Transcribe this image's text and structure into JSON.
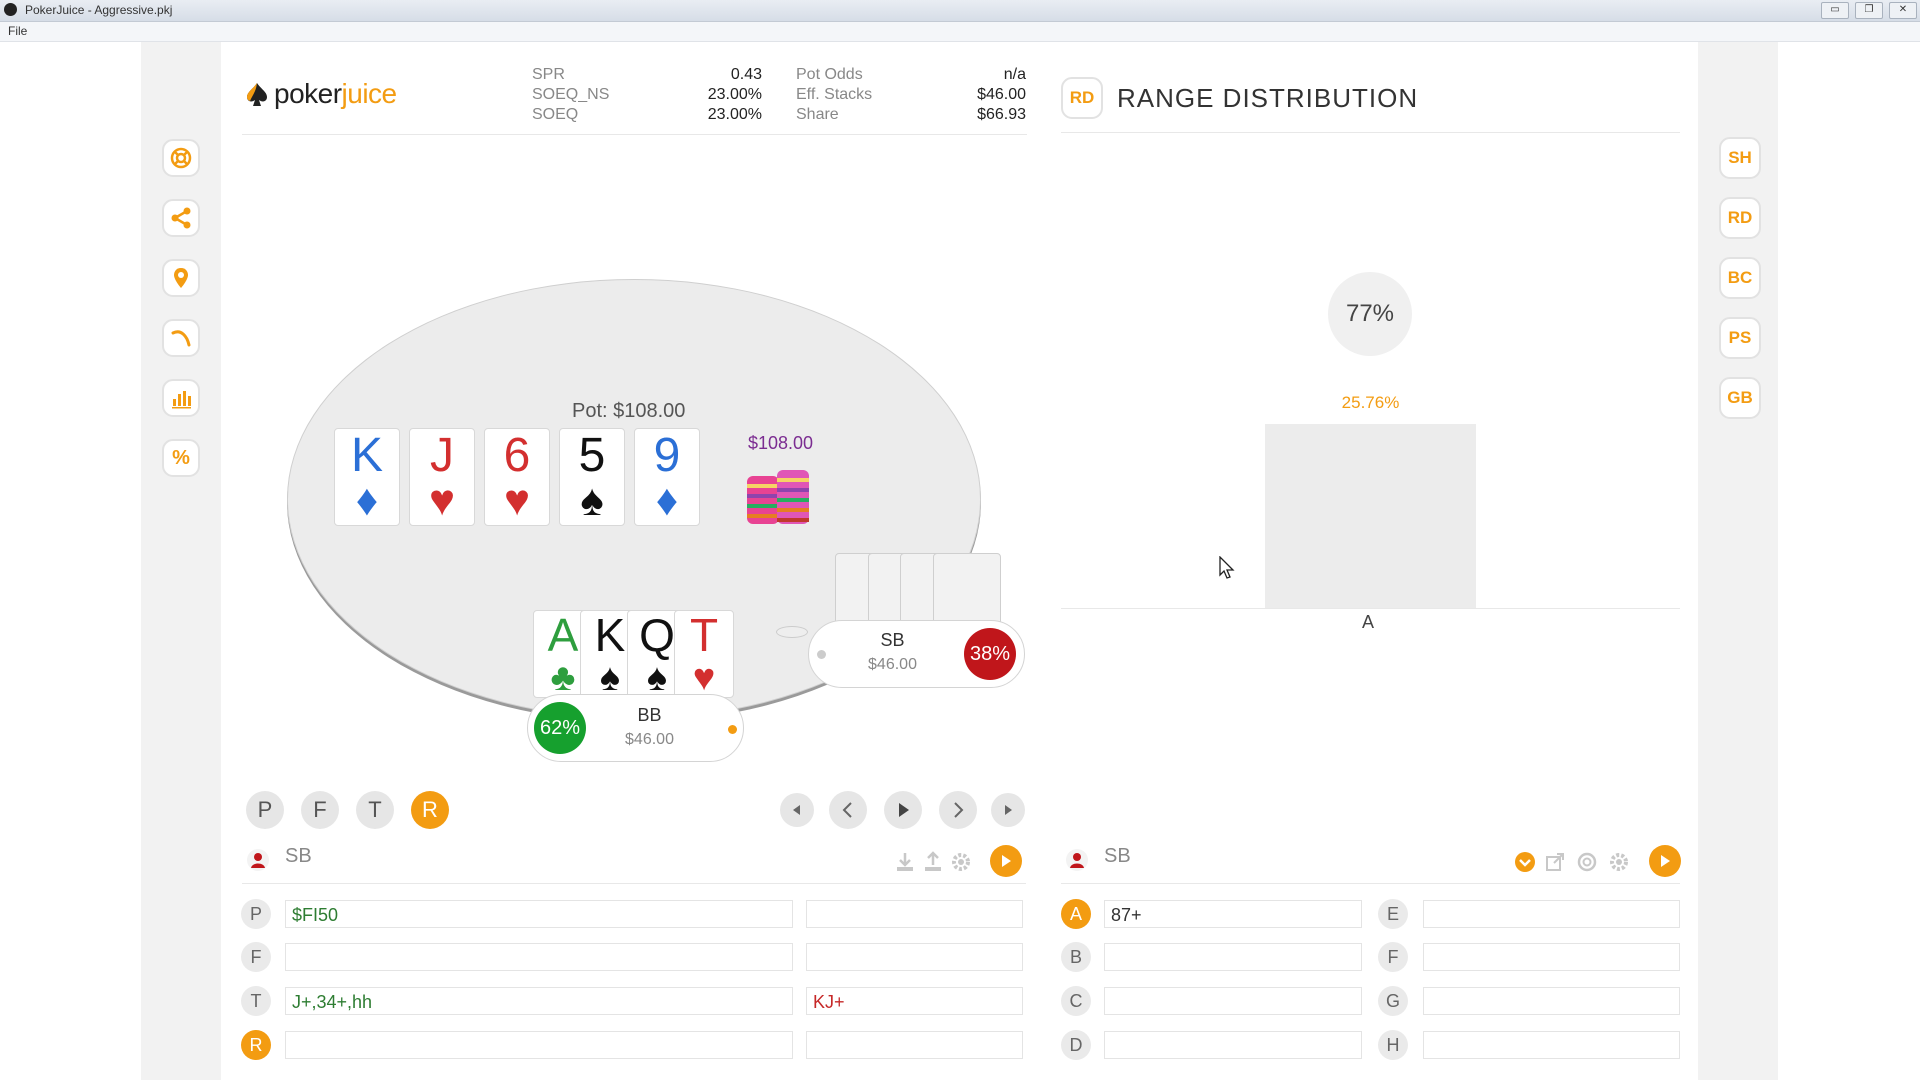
{
  "window": {
    "title": "PokerJuice - Aggressive.pkj",
    "min": "▭",
    "restore": "❐",
    "close": "✕"
  },
  "menu": {
    "file": "File"
  },
  "logo": {
    "part1": "poker",
    "part2": "juice"
  },
  "stats": {
    "col1": [
      {
        "label": "SPR",
        "value": "0.43"
      },
      {
        "label": "SOEQ_NS",
        "value": "23.00%"
      },
      {
        "label": "SOEQ",
        "value": "23.00%"
      }
    ],
    "col2": [
      {
        "label": "Pot Odds",
        "value": "n/a"
      },
      {
        "label": "Eff. Stacks",
        "value": "$46.00"
      },
      {
        "label": "Share",
        "value": "$66.93"
      }
    ]
  },
  "left_tools": [
    "lifebuoy-icon",
    "share-icon",
    "location-pin-icon",
    "curve-icon",
    "bar-chart-icon",
    "percent-icon"
  ],
  "left_tools_percent": "%",
  "right_tools": [
    "SH",
    "RD",
    "BC",
    "PS",
    "GB"
  ],
  "table": {
    "pot": "Pot: $108.00",
    "chip_amount": "$108.00",
    "board": [
      {
        "rank": "K",
        "suit": "♦",
        "color": "#2b6fd6"
      },
      {
        "rank": "J",
        "suit": "♥",
        "color": "#d32f2f"
      },
      {
        "rank": "6",
        "suit": "♥",
        "color": "#d32f2f"
      },
      {
        "rank": "5",
        "suit": "♠",
        "color": "#111111"
      },
      {
        "rank": "9",
        "suit": "♦",
        "color": "#2b6fd6"
      }
    ],
    "hero_cards": [
      {
        "rank": "A",
        "suit": "♣",
        "color": "#2e9e3e"
      },
      {
        "rank": "K",
        "suit": "♠",
        "color": "#111111"
      },
      {
        "rank": "Q",
        "suit": "♠",
        "color": "#111111"
      },
      {
        "rank": "T",
        "suit": "♥",
        "color": "#d32f2f"
      }
    ],
    "sb": {
      "name": "SB",
      "stack": "$46.00",
      "equity": "38%",
      "color": "#c0161b"
    },
    "bb": {
      "name": "BB",
      "stack": "$46.00",
      "equity": "62%",
      "color": "#16a02e"
    }
  },
  "streets": [
    {
      "label": "P",
      "active": false
    },
    {
      "label": "F",
      "active": false
    },
    {
      "label": "T",
      "active": false
    },
    {
      "label": "R",
      "active": true
    }
  ],
  "left_panel": {
    "player": "SB",
    "rows": [
      {
        "letter": "P",
        "active": false,
        "range": "$FI50",
        "hand": ""
      },
      {
        "letter": "F",
        "active": false,
        "range": "",
        "hand": ""
      },
      {
        "letter": "T",
        "active": false,
        "range": "J+,34+,hh",
        "hand": "KJ+"
      },
      {
        "letter": "R",
        "active": true,
        "range": "",
        "hand": ""
      }
    ]
  },
  "range_distribution": {
    "badge": "RD",
    "title": "RANGE DISTRIBUTION",
    "total": "77%",
    "bar_value": "25.76%",
    "category": "A"
  },
  "right_panel": {
    "player": "SB",
    "left_rows": [
      {
        "letter": "A",
        "active": true,
        "value": "87+"
      },
      {
        "letter": "B",
        "active": false,
        "value": ""
      },
      {
        "letter": "C",
        "active": false,
        "value": ""
      },
      {
        "letter": "D",
        "active": false,
        "value": ""
      }
    ],
    "right_rows": [
      {
        "letter": "E",
        "value": ""
      },
      {
        "letter": "F",
        "value": ""
      },
      {
        "letter": "G",
        "value": ""
      },
      {
        "letter": "H",
        "value": ""
      }
    ]
  },
  "accent_color": "#f39c12"
}
